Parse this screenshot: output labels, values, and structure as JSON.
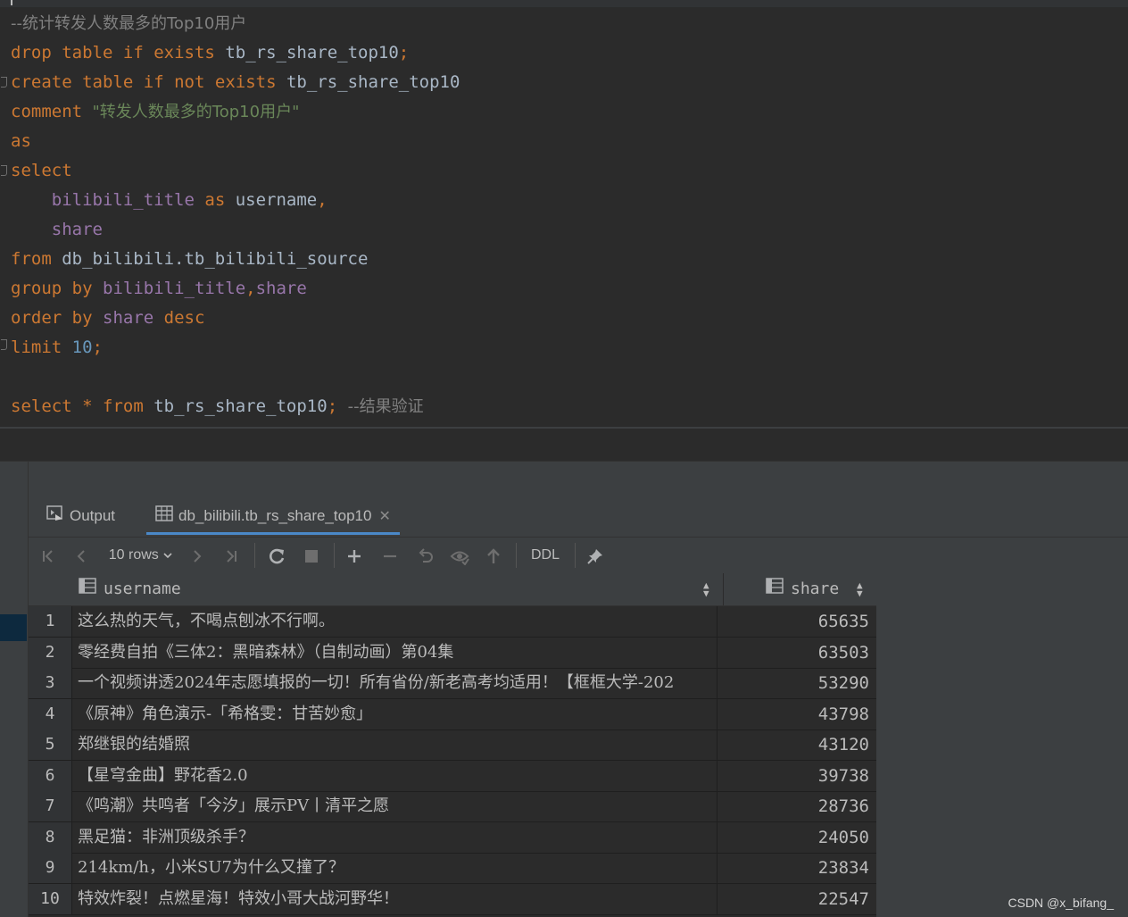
{
  "editor": {
    "lines": [
      {
        "comment": "--统计转发人数最多的Top10用户"
      },
      {
        "kw1": "drop",
        "kw2": "table",
        "kw3": "if",
        "kw4": "exists",
        "ident": "tb_rs_share_top10",
        "end": ";"
      },
      {
        "kw1": "create",
        "kw2": "table",
        "kw3": "if",
        "kw4": "not",
        "kw5": "exists",
        "ident": "tb_rs_share_top10"
      },
      {
        "kw1": "comment",
        "str": "\"转发人数最多的Top10用户\""
      },
      {
        "kw1": "as"
      },
      {
        "kw1": "select"
      },
      {
        "col1": "bilibili_title",
        "kw1": "as",
        "ident": "username",
        "comma": ","
      },
      {
        "col1": "share"
      },
      {
        "kw1": "from",
        "ident": "db_bilibili.tb_bilibili_source"
      },
      {
        "kw1": "group",
        "kw2": "by",
        "col1": "bilibili_title",
        "comma": ",",
        "col2": "share"
      },
      {
        "kw1": "order",
        "kw2": "by",
        "col1": "share",
        "kw3": "desc"
      },
      {
        "kw1": "limit",
        "num": "10",
        "end": ";"
      },
      {
        "kw1": "select",
        "star": "*",
        "kw2": "from",
        "ident": "tb_rs_share_top10",
        "end": ";",
        "comment": "--结果验证"
      }
    ]
  },
  "panel": {
    "tabs": [
      {
        "label": "Output",
        "icon": "output-icon"
      },
      {
        "label": "db_bilibili.tb_rs_share_top10",
        "icon": "table-icon",
        "close": "✕"
      }
    ],
    "toolbar": {
      "rows_label": "10 rows",
      "ddl_label": "DDL",
      "icons": [
        "first-page-icon",
        "previous-page-icon",
        "next-page-icon",
        "last-page-icon",
        "refresh-icon",
        "stop-icon",
        "add-row-icon",
        "delete-row-icon",
        "revert-icon",
        "preview-changes-icon",
        "submit-icon",
        "pin-icon"
      ]
    },
    "grid": {
      "columns": [
        "username",
        "share"
      ],
      "rows": [
        {
          "n": "1",
          "username": "这么热的天气，不喝点刨冰不行啊。",
          "share": "65635"
        },
        {
          "n": "2",
          "username": "零经费自拍《三体2：黑暗森林》（自制动画）第04集",
          "share": "63503"
        },
        {
          "n": "3",
          "username": "一个视频讲透2024年志愿填报的一切！所有省份/新老高考均适用！【框框大学-202",
          "share": "53290"
        },
        {
          "n": "4",
          "username": "《原神》角色演示-「希格雯：甘苦妙愈」",
          "share": "43798"
        },
        {
          "n": "5",
          "username": "郑继银的结婚照",
          "share": "43120"
        },
        {
          "n": "6",
          "username": "【星穹金曲】野花香2.0",
          "share": "39738"
        },
        {
          "n": "7",
          "username": "《鸣潮》共鸣者「今汐」展示PV丨清平之愿",
          "share": "28736"
        },
        {
          "n": "8",
          "username": "黑足猫：非洲顶级杀手？",
          "share": "24050"
        },
        {
          "n": "9",
          "username": "214km/h，小米SU7为什么又撞了？",
          "share": "23834"
        },
        {
          "n": "10",
          "username": "特效炸裂！点燃星海！特效小哥大战河野华！",
          "share": "22547"
        }
      ]
    }
  },
  "watermark": "CSDN @x_bifang_"
}
